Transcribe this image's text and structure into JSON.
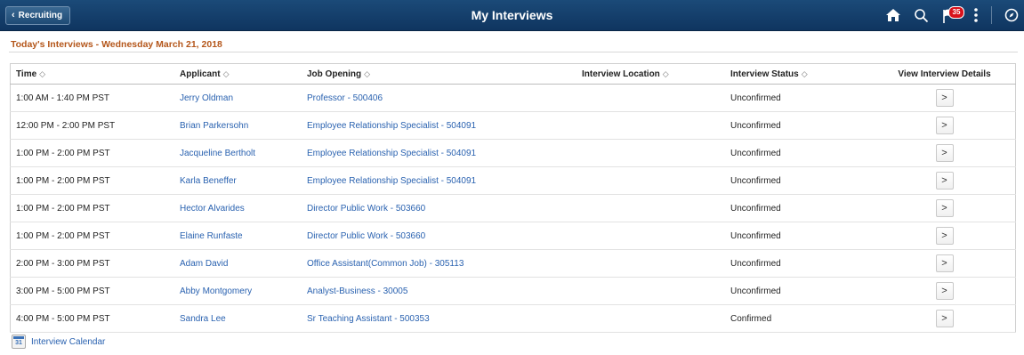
{
  "header": {
    "back_label": "Recruiting",
    "title": "My Interviews",
    "notification_count": "35",
    "icons": [
      "home-icon",
      "search-icon",
      "flag-icon",
      "more-icon",
      "navbar-compass-icon"
    ]
  },
  "section": {
    "title": "Today's Interviews - Wednesday March 21, 2018"
  },
  "table": {
    "columns": [
      "Time",
      "Applicant",
      "Job Opening",
      "Interview Location",
      "Interview Status",
      "View Interview Details"
    ],
    "rows": [
      {
        "time": "1:00 AM - 1:40 PM PST",
        "applicant": "Jerry Oldman",
        "job": "Professor - 500406",
        "location": "",
        "status": "Unconfirmed",
        "details": ">"
      },
      {
        "time": "12:00 PM - 2:00 PM PST",
        "applicant": "Brian Parkersohn",
        "job": "Employee Relationship Specialist - 504091",
        "location": "",
        "status": "Unconfirmed",
        "details": ">"
      },
      {
        "time": "1:00 PM - 2:00 PM PST",
        "applicant": "Jacqueline Bertholt",
        "job": "Employee Relationship Specialist - 504091",
        "location": "",
        "status": "Unconfirmed",
        "details": ">"
      },
      {
        "time": "1:00 PM - 2:00 PM PST",
        "applicant": "Karla Beneffer",
        "job": "Employee Relationship Specialist - 504091",
        "location": "",
        "status": "Unconfirmed",
        "details": ">"
      },
      {
        "time": "1:00 PM - 2:00 PM PST",
        "applicant": "Hector Alvarides",
        "job": "Director Public Work - 503660",
        "location": "",
        "status": "Unconfirmed",
        "details": ">"
      },
      {
        "time": "1:00 PM - 2:00 PM PST",
        "applicant": "Elaine Runfaste",
        "job": "Director Public Work - 503660",
        "location": "",
        "status": "Unconfirmed",
        "details": ">"
      },
      {
        "time": "2:00 PM - 3:00 PM PST",
        "applicant": "Adam David",
        "job": "Office Assistant(Common Job) - 305113",
        "location": "",
        "status": "Unconfirmed",
        "details": ">"
      },
      {
        "time": "3:00 PM - 5:00 PM PST",
        "applicant": "Abby Montgomery",
        "job": "Analyst-Business - 30005",
        "location": "",
        "status": "Unconfirmed",
        "details": ">"
      },
      {
        "time": "4:00 PM - 5:00 PM PST",
        "applicant": "Sandra Lee",
        "job": "Sr Teaching Assistant - 500353",
        "location": "",
        "status": "Confirmed",
        "details": ">"
      }
    ]
  },
  "footer": {
    "calendar_link": "Interview Calendar",
    "calendar_icon_text": "31"
  },
  "colors": {
    "nav_bar": "#1b4a78",
    "section_title": "#b4561a",
    "link": "#2a62b0",
    "badge": "#d8121c"
  }
}
